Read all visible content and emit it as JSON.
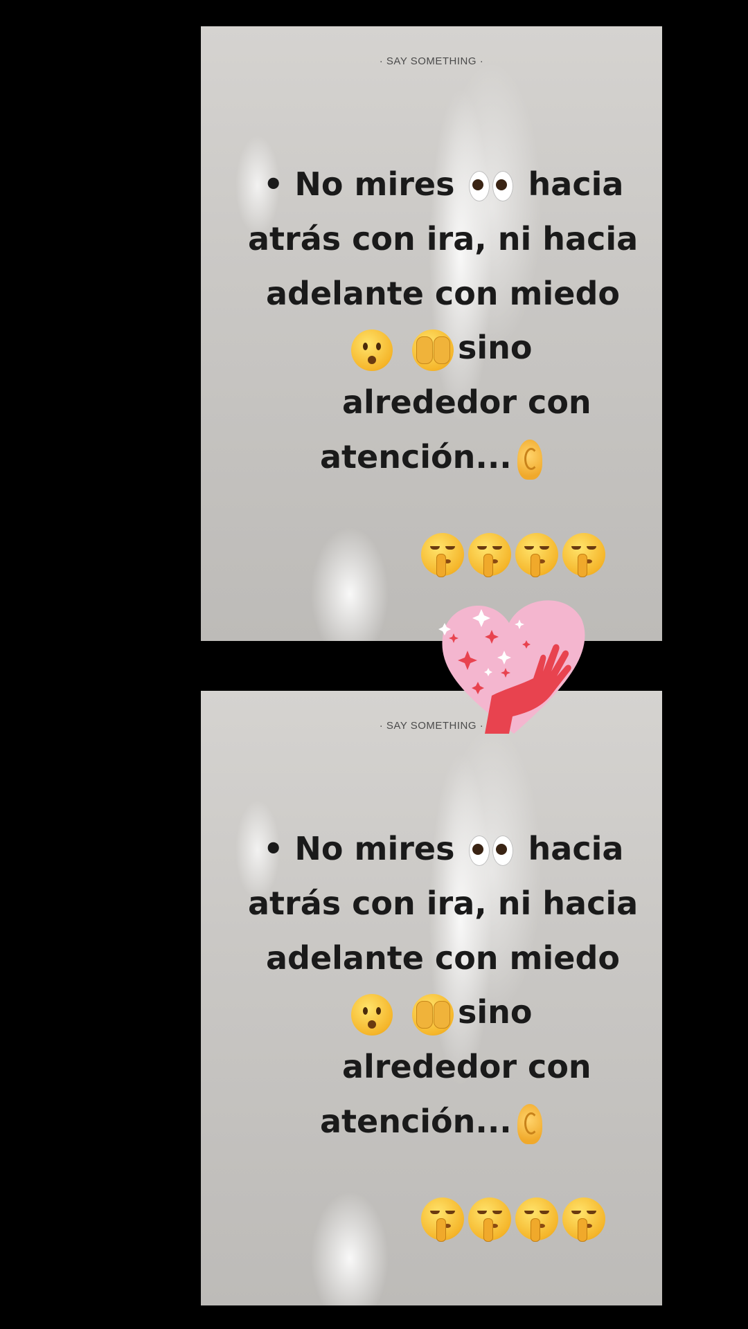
{
  "cards": [
    {
      "brand": "· SAY SOMETHING ·",
      "quote": {
        "line1_a": "• No mires",
        "line1_b": "hacia",
        "line2": "atrás con ira, ni  hacia",
        "line3": "adelante con miedo",
        "line4": "sino",
        "line5": "alrededor con",
        "line6": "atención..."
      },
      "emojis": [
        "eyes-icon",
        "worried-face-icon",
        "face-with-hand-over-mouth-icon",
        "ear-icon",
        "shushing-face-icon"
      ],
      "shush_count": 4
    },
    {
      "brand": "· SAY SOMETHING ·",
      "quote": {
        "line1_a": "• No mires",
        "line1_b": "hacia",
        "line2": "atrás con ira, ni  hacia",
        "line3": "adelante con miedo",
        "line4": "sino",
        "line5": "alrededor con",
        "line6": "atención..."
      },
      "emojis": [
        "eyes-icon",
        "worried-face-icon",
        "face-with-hand-over-mouth-icon",
        "ear-icon",
        "shushing-face-icon"
      ],
      "shush_count": 4
    }
  ],
  "sticker": {
    "icon": "heart-hand-sparkles-icon",
    "colors": {
      "heart": "#f4b6cf",
      "hand": "#e8434f",
      "sparkle": "#e8434f",
      "star": "#ffffff"
    }
  },
  "colors": {
    "page_background": "#000000",
    "card_background": "#cfcdca",
    "text": "#1a1a1a",
    "brand_text": "#4a4a4a"
  }
}
